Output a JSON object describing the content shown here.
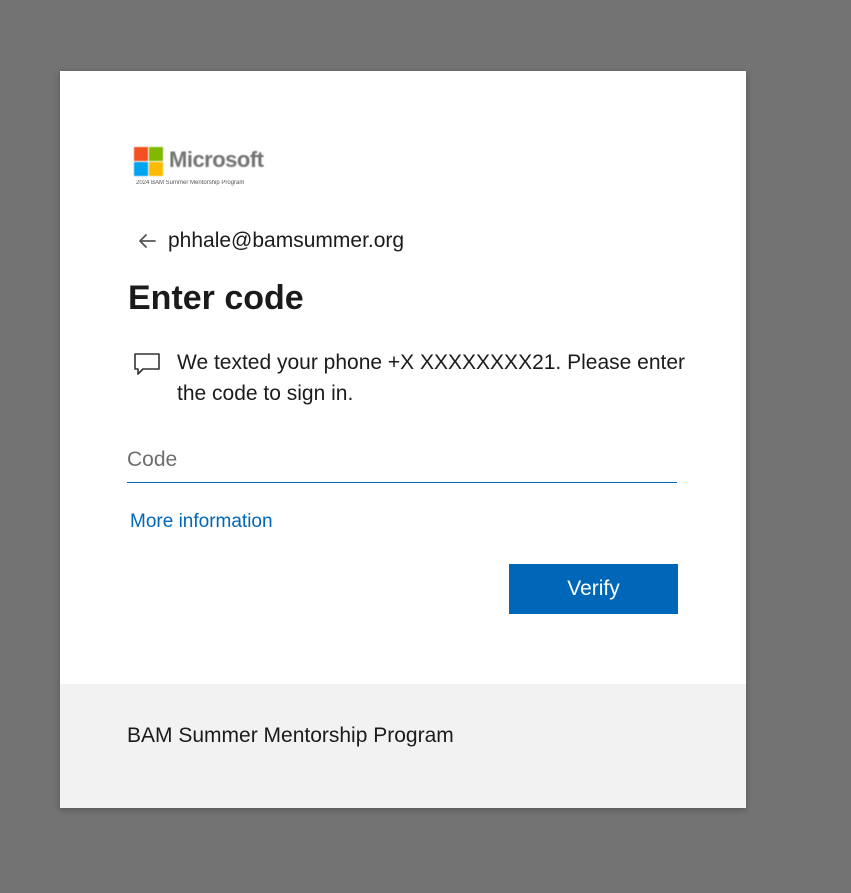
{
  "logo": {
    "brand": "Microsoft",
    "subtitle": "2024 BAM Summer Mentorship Program",
    "icon": "microsoft-logo-icon",
    "colors": [
      "#f25022",
      "#7fba00",
      "#00a4ef",
      "#ffb900"
    ]
  },
  "identity": {
    "back_icon": "arrow-left-icon",
    "email": "phhale@bamsummer.org"
  },
  "title": "Enter code",
  "message": {
    "icon": "chat-bubble-icon",
    "text": "We texted your phone +X XXXXXXXX21. Please enter the code to sign in."
  },
  "code_field": {
    "placeholder": "Code",
    "value": ""
  },
  "more_info_link": "More information",
  "verify_button": "Verify",
  "footer": {
    "text": "BAM Summer Mentorship Program"
  },
  "colors": {
    "accent": "#0067b8",
    "backdrop": "#737373",
    "footer_bg": "#f2f2f2"
  }
}
